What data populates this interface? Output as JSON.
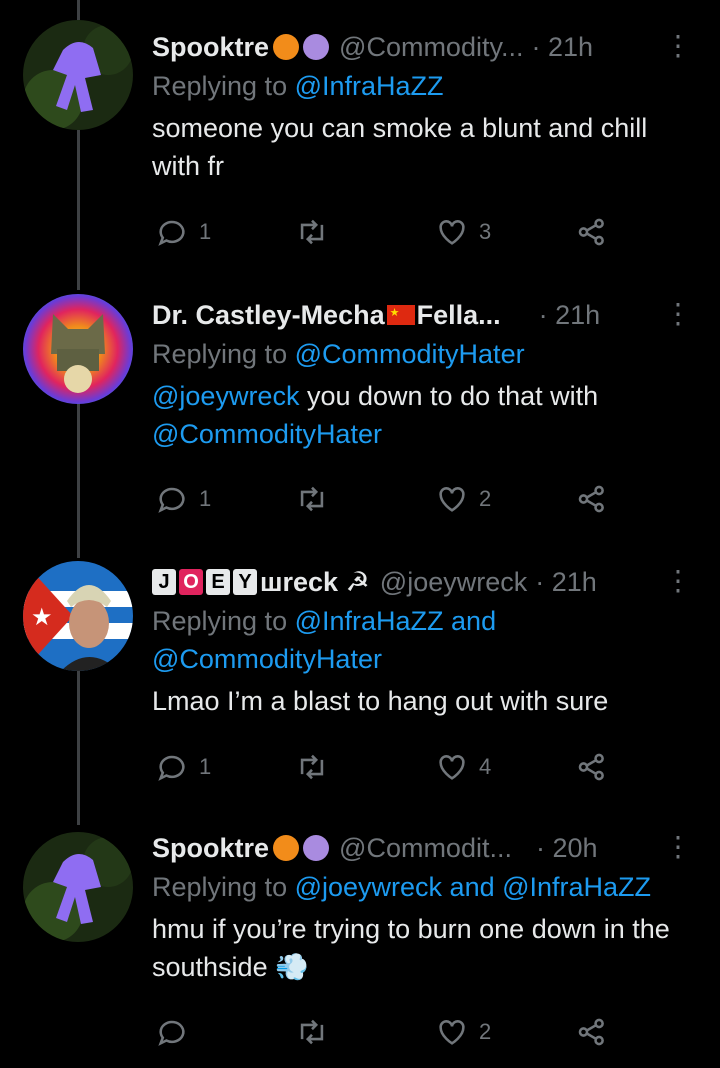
{
  "tweets": [
    {
      "name": "Spooktre",
      "handle": "@Commodity...",
      "time": "· 21h",
      "replying_label": "Replying to",
      "replying_to": "@InfraHaZZ",
      "replying_extra": "",
      "mention": "",
      "text": "someone you can smoke a blunt and chill with fr",
      "text_extra": "",
      "replies": "1",
      "retweets": "",
      "likes": "3"
    },
    {
      "name": "Dr. Castley-Mecha",
      "name_suffix": "Fella...",
      "handle": "",
      "time": "· 21h",
      "replying_label": "Replying to",
      "replying_to": "@CommodityHater",
      "mention": "@joeywreck",
      "text": "you down to do that with",
      "text_link": "@CommodityHater",
      "replies": "1",
      "retweets": "",
      "likes": "2"
    },
    {
      "name_boxes": [
        "J",
        "O",
        "E",
        "Y"
      ],
      "name_tail": "шreck ☭",
      "handle": "@joeywreck",
      "time": "· 21h",
      "replying_label": "Replying to",
      "replying_to": "@InfraHaZZ and",
      "replying_to_2": "@CommodityHater",
      "text": "Lmao I’m a blast to hang out with sure",
      "replies": "1",
      "retweets": "",
      "likes": "4"
    },
    {
      "name": "Spooktre",
      "handle": "@Commodit...",
      "time": "· 20h",
      "replying_label": "Replying to",
      "replying_to": "@joeywreck and @InfraHaZZ",
      "text": "hmu if you’re trying to burn one down in the southside 💨",
      "replies": "",
      "retweets": "",
      "likes": "2"
    }
  ],
  "icons": {
    "more": "more-options-icon",
    "reply": "reply-icon",
    "retweet": "retweet-icon",
    "like": "like-icon",
    "share": "share-icon"
  },
  "colors": {
    "background": "#000000",
    "link": "#1d9bf0",
    "muted": "#71767b",
    "text": "#e7e9ea"
  }
}
